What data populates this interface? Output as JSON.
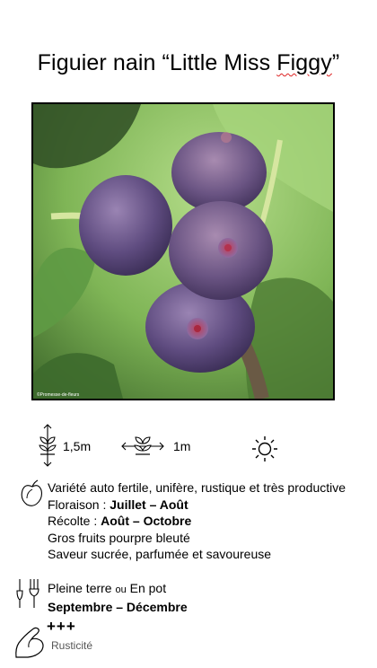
{
  "title_main": "Figuier nain “Little Miss ",
  "title_flag": "Figgy",
  "title_end": "”",
  "photo": {
    "credit": "©Promesse-de-fleurs"
  },
  "specs": {
    "height": "1,5m",
    "width": "1m"
  },
  "description": {
    "line1": "Variété auto fertile, unifère, rustique et très productive",
    "floraison_label": "Floraison : ",
    "floraison_value": "Juillet – Août",
    "recolte_label": "Récolte  : ",
    "recolte_value": "Août – Octobre",
    "line4": "Gros fruits pourpre bleuté",
    "line5": "Saveur sucrée, parfumée et savoureuse"
  },
  "planting": {
    "option1": "Pleine terre ",
    "or": "ou",
    "option2": " En pot",
    "period": "Septembre – Décembre"
  },
  "hardiness": {
    "marks": "+++",
    "label": "Rusticité"
  },
  "icons": [
    "height-icon",
    "width-icon",
    "sun-icon",
    "fruit-icon",
    "tools-icon",
    "arm-icon"
  ]
}
